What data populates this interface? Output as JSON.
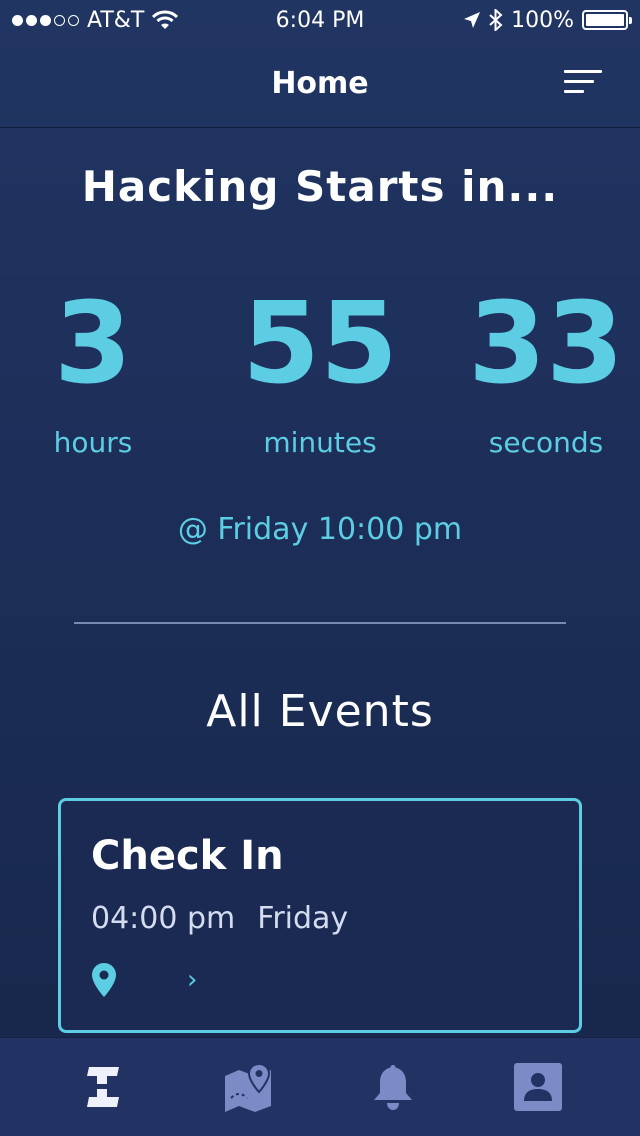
{
  "status_bar": {
    "carrier": "AT&T",
    "time": "6:04 PM",
    "battery": "100%",
    "signal_bars_filled": 3,
    "signal_bars_total": 5
  },
  "nav": {
    "title": "Home",
    "menu_icon": "filter-menu-icon"
  },
  "countdown": {
    "headline": "Hacking Starts in...",
    "hours": {
      "value": "3",
      "label": "hours"
    },
    "minutes": {
      "value": "55",
      "label": "minutes"
    },
    "seconds": {
      "value": "33",
      "label": "seconds"
    },
    "start_time": "@ Friday 10:00 pm"
  },
  "events": {
    "title": "All Events",
    "items": [
      {
        "name": "Check In",
        "time": "04:00 pm",
        "day": "Friday",
        "location": ""
      }
    ]
  },
  "tab_bar": {
    "items": [
      {
        "icon": "home-logo-icon",
        "selected": true
      },
      {
        "icon": "map-icon",
        "selected": false
      },
      {
        "icon": "bell-icon",
        "selected": false
      },
      {
        "icon": "profile-icon",
        "selected": false
      }
    ]
  },
  "colors": {
    "background": "#1f3160",
    "accent": "#5ccde3",
    "tab_bar": "#223363",
    "inactive_icon": "#7c8ac6"
  }
}
